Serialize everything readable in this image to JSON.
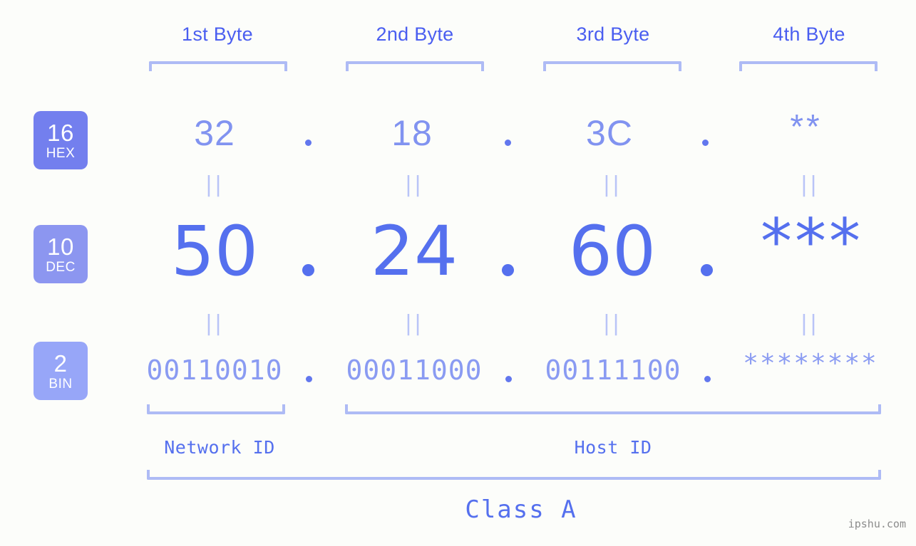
{
  "background_color": "#fcfdfa",
  "accent_colors": {
    "header_text": "#4a5ef0",
    "bracket": "#aebbf5",
    "hex_value": "#8193f0",
    "dec_value": "#5570ee",
    "bin_value": "#8a9bf2",
    "badge_hex": "#737fee",
    "badge_dec": "#8c96f0",
    "badge_bin": "#97a6f8",
    "equals_mark": "#b9c4f7",
    "caption": "#5570ee",
    "watermark": "#8c8c8c"
  },
  "byte_headers": [
    {
      "label": "1st Byte"
    },
    {
      "label": "2nd Byte"
    },
    {
      "label": "3rd Byte"
    },
    {
      "label": "4th Byte"
    }
  ],
  "rows": [
    {
      "badge": {
        "number": "16",
        "name": "HEX"
      },
      "values": [
        "32",
        "18",
        "3C",
        "**"
      ],
      "separator": "."
    },
    {
      "badge": {
        "number": "10",
        "name": "DEC"
      },
      "values": [
        "50",
        "24",
        "60",
        "***"
      ],
      "separator": "."
    },
    {
      "badge": {
        "number": "2",
        "name": "BIN"
      },
      "values": [
        "00110010",
        "00011000",
        "00111100",
        "********"
      ],
      "separator": "."
    }
  ],
  "equals_mark": "||",
  "id_sections": [
    {
      "label": "Network ID"
    },
    {
      "label": "Host ID"
    }
  ],
  "class_label": "Class A",
  "watermark": "ipshu.com"
}
